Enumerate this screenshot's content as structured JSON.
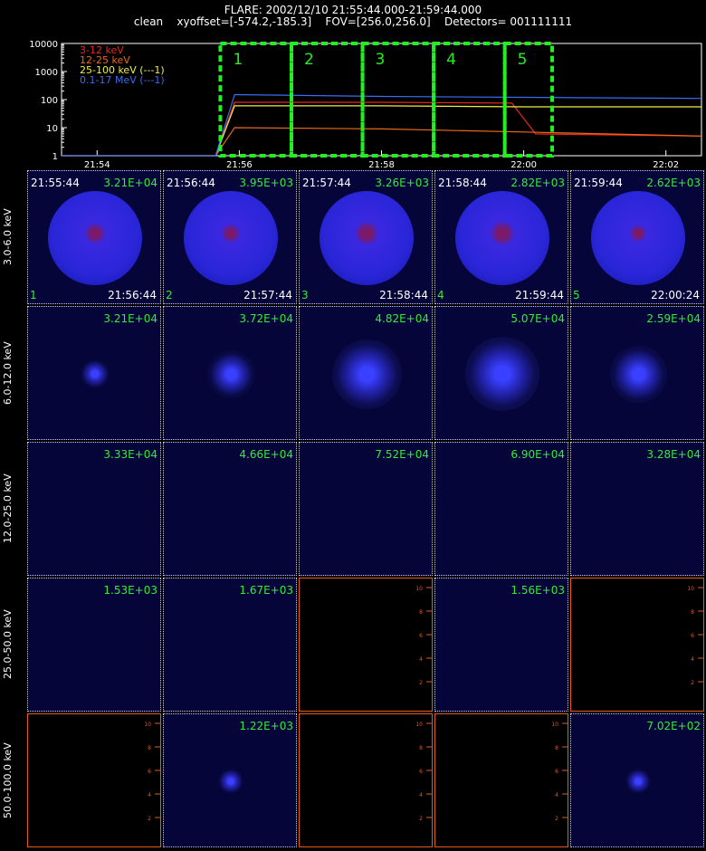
{
  "header": {
    "line1": "FLARE: 2002/12/10 21:55:44.000-21:59:44.000",
    "line2": "clean    xyoffset=[-574.2,-185.3]    FOV=[256.0,256.0]    Detectors= 001111111"
  },
  "chart_data": [
    {
      "type": "line",
      "title": "",
      "yscale": "log",
      "ylim": [
        1,
        10000
      ],
      "yticks": [
        "10000",
        "1000",
        "100",
        "10",
        "1"
      ],
      "xticks": [
        "21:54",
        "21:56",
        "21:58",
        "22:00",
        "22:02"
      ],
      "xlim": [
        "21:53:30",
        "22:02:30"
      ],
      "legend_position": "top-left",
      "legend": [
        {
          "label": "3-12 keV",
          "color": "#e8281c"
        },
        {
          "label": "12-25 keV",
          "color": "#e86a1c"
        },
        {
          "label": "25-100 keV  (---1)",
          "color": "#f0f040"
        },
        {
          "label": "0.1-17 MeV  (---1)",
          "color": "#3a6cf0"
        }
      ],
      "series": [
        {
          "name": "3-12 keV",
          "color": "#e8281c",
          "x": [
            "21:53:30",
            "21:55:40",
            "21:55:56",
            "21:58:00",
            "21:59:50",
            "22:00:10",
            "22:02:30"
          ],
          "y": [
            1,
            1,
            80,
            80,
            75,
            6,
            5
          ]
        },
        {
          "name": "12-25 keV",
          "color": "#e86a1c",
          "x": [
            "21:53:30",
            "21:55:40",
            "21:55:56",
            "21:58:00",
            "22:00:00",
            "22:02:30"
          ],
          "y": [
            1,
            1,
            10,
            9,
            7,
            5
          ]
        },
        {
          "name": "25-100 keV  (---1)",
          "color": "#f0f040",
          "x": [
            "21:53:30",
            "21:55:40",
            "21:55:56",
            "21:58:00",
            "22:00:00",
            "22:02:30"
          ],
          "y": [
            1,
            1,
            60,
            60,
            55,
            55
          ]
        },
        {
          "name": "0.1-17 MeV  (---1)",
          "color": "#3a6cf0",
          "x": [
            "21:53:30",
            "21:55:40",
            "21:55:56",
            "21:58:00",
            "22:00:00",
            "22:02:30"
          ],
          "y": [
            1,
            1,
            150,
            130,
            120,
            110
          ]
        }
      ],
      "intervals": [
        {
          "label": "1",
          "start": "21:55:44",
          "end": "21:56:44"
        },
        {
          "label": "2",
          "start": "21:56:44",
          "end": "21:57:44"
        },
        {
          "label": "3",
          "start": "21:57:44",
          "end": "21:58:44"
        },
        {
          "label": "4",
          "start": "21:58:44",
          "end": "21:59:44"
        },
        {
          "label": "5",
          "start": "21:59:44",
          "end": "22:00:24"
        }
      ],
      "interval_color": "#22ee22"
    },
    {
      "type": "heatmap",
      "title": "",
      "rows": [
        {
          "label": "3.0-6.0 keV",
          "cells": [
            {
              "max": "3.21E+04",
              "level": 1.0,
              "core": 0.5
            },
            {
              "max": "3.95E+03",
              "level": 1.0,
              "core": 0.45
            },
            {
              "max": "3.26E+03",
              "level": 1.0,
              "core": 0.55
            },
            {
              "max": "2.82E+03",
              "level": 1.0,
              "core": 0.6
            },
            {
              "max": "2.62E+03",
              "level": 1.0,
              "core": 0.4
            }
          ]
        },
        {
          "label": "6.0-12.0 keV",
          "cells": [
            {
              "max": "3.21E+04",
              "level": 0.15
            },
            {
              "max": "3.72E+04",
              "level": 0.35
            },
            {
              "max": "4.82E+04",
              "level": 0.6
            },
            {
              "max": "5.07E+04",
              "level": 0.65
            },
            {
              "max": "2.59E+04",
              "level": 0.45
            }
          ]
        },
        {
          "label": "12.0-25.0 keV",
          "cells": [
            {
              "max": "3.33E+04",
              "level": 0.0
            },
            {
              "max": "4.66E+04",
              "level": 0.0
            },
            {
              "max": "7.52E+04",
              "level": 0.0
            },
            {
              "max": "6.90E+04",
              "level": 0.0
            },
            {
              "max": "3.28E+04",
              "level": 0.0
            }
          ]
        },
        {
          "label": "25.0-50.0 keV",
          "cells": [
            {
              "max": "1.53E+03",
              "level": 0.0
            },
            {
              "max": "1.67E+03",
              "level": 0.0
            },
            {
              "max": "",
              "level": 0.0,
              "empty": true
            },
            {
              "max": "1.56E+03",
              "level": 0.0
            },
            {
              "max": "",
              "level": 0.0,
              "empty": true
            }
          ]
        },
        {
          "label": "50.0-100.0 keV",
          "cells": [
            {
              "max": "",
              "level": 0.0,
              "empty": true
            },
            {
              "max": "1.22E+03",
              "level": 0.1
            },
            {
              "max": "",
              "level": 0.0,
              "empty": true
            },
            {
              "max": "",
              "level": 0.0,
              "empty": true
            },
            {
              "max": "7.02E+02",
              "level": 0.1
            }
          ]
        }
      ],
      "columns": [
        {
          "start": "21:55:44",
          "end": "21:56:44",
          "num": "1"
        },
        {
          "start": "21:56:44",
          "end": "21:57:44",
          "num": "2"
        },
        {
          "start": "21:57:44",
          "end": "21:58:44",
          "num": "3"
        },
        {
          "start": "21:58:44",
          "end": "21:59:44",
          "num": "4"
        },
        {
          "start": "21:59:44",
          "end": "22:00:24",
          "num": "5"
        }
      ],
      "empty_axis_ticks": [
        "2",
        "4",
        "6",
        "8",
        "10"
      ]
    }
  ]
}
